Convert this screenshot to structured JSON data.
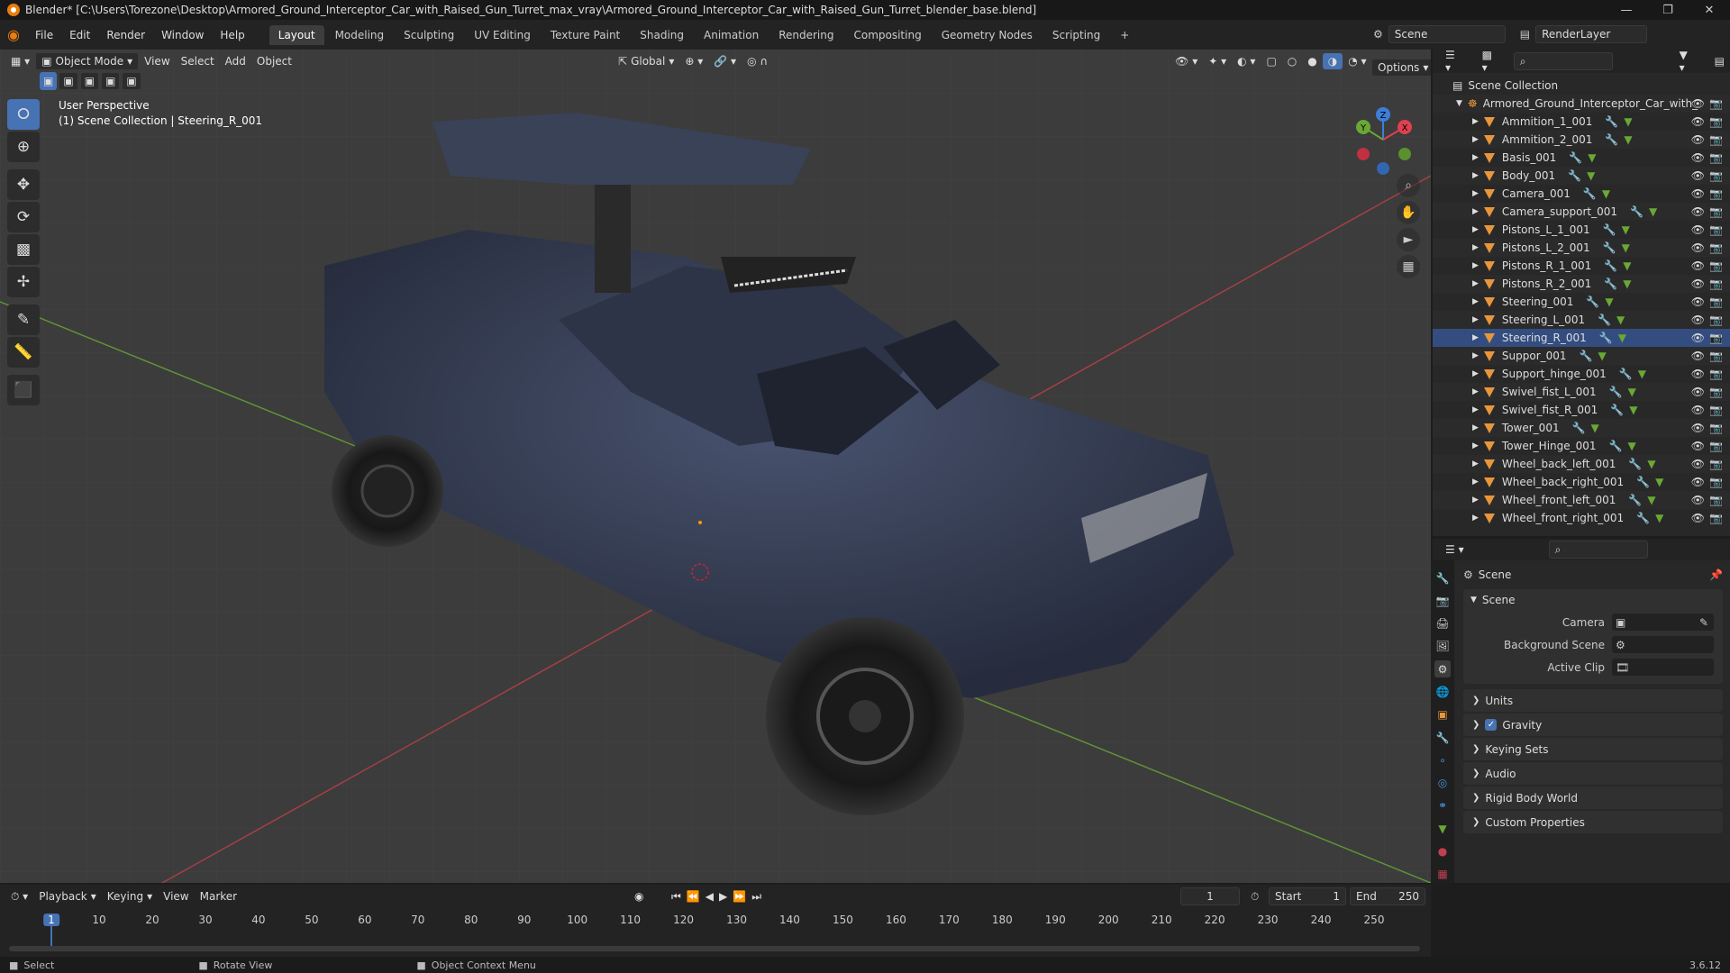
{
  "window": {
    "title": "Blender* [C:\\Users\\Torezone\\Desktop\\Armored_Ground_Interceptor_Car_with_Raised_Gun_Turret_max_vray\\Armored_Ground_Interceptor_Car_with_Raised_Gun_Turret_blender_base.blend]"
  },
  "menu": {
    "items": [
      "File",
      "Edit",
      "Render",
      "Window",
      "Help"
    ],
    "workspaces": [
      "Layout",
      "Modeling",
      "Sculpting",
      "UV Editing",
      "Texture Paint",
      "Shading",
      "Animation",
      "Rendering",
      "Compositing",
      "Geometry Nodes",
      "Scripting"
    ],
    "active_workspace": "Layout",
    "scene_name": "Scene",
    "render_layer": "RenderLayer"
  },
  "viewport": {
    "mode": "Object Mode",
    "menus": [
      "View",
      "Select",
      "Add",
      "Object"
    ],
    "transform_orientation": "Global",
    "options_label": "Options",
    "overlay_title": "User Perspective",
    "overlay_subtitle": "(1) Scene Collection | Steering_R_001",
    "gizmo_axes": [
      "X",
      "Y",
      "Z"
    ]
  },
  "outliner": {
    "root": "Scene Collection",
    "collection": "Armored_Ground_Interceptor_Car_with_",
    "selected": "Steering_R_001",
    "objects": [
      "Ammition_1_001",
      "Ammition_2_001",
      "Basis_001",
      "Body_001",
      "Camera_001",
      "Camera_support_001",
      "Pistons_L_1_001",
      "Pistons_L_2_001",
      "Pistons_R_1_001",
      "Pistons_R_2_001",
      "Steering_001",
      "Steering_L_001",
      "Steering_R_001",
      "Suppor_001",
      "Support_hinge_001",
      "Swivel_fist_L_001",
      "Swivel_fist_R_001",
      "Tower_001",
      "Tower_Hinge_001",
      "Wheel_back_left_001",
      "Wheel_back_right_001",
      "Wheel_front_left_001",
      "Wheel_front_right_001"
    ]
  },
  "properties": {
    "header": "Scene",
    "panel_title": "Scene",
    "fields": [
      {
        "label": "Camera",
        "value": ""
      },
      {
        "label": "Background Scene",
        "value": ""
      },
      {
        "label": "Active Clip",
        "value": ""
      }
    ],
    "subpanels": [
      "Units",
      "Gravity",
      "Keying Sets",
      "Audio",
      "Rigid Body World",
      "Custom Properties"
    ],
    "gravity_checked": true
  },
  "timeline": {
    "menus": [
      "Playback",
      "Keying",
      "View",
      "Marker"
    ],
    "current_frame": "1",
    "start_label": "Start",
    "start": "1",
    "end_label": "End",
    "end": "250",
    "ticks": [
      "1",
      "10",
      "20",
      "30",
      "40",
      "50",
      "60",
      "70",
      "80",
      "90",
      "100",
      "110",
      "120",
      "130",
      "140",
      "150",
      "160",
      "170",
      "180",
      "190",
      "200",
      "210",
      "220",
      "230",
      "240",
      "250"
    ]
  },
  "status": {
    "select": "Select",
    "rotate": "Rotate View",
    "context": "Object Context Menu",
    "version": "3.6.12"
  },
  "colors": {
    "accent": "#4772b3",
    "object_icon": "#e8963c",
    "selected_row": "#334d80",
    "axis_x": "#e04050",
    "axis_y": "#6aa834",
    "axis_z": "#3b7fd9"
  }
}
